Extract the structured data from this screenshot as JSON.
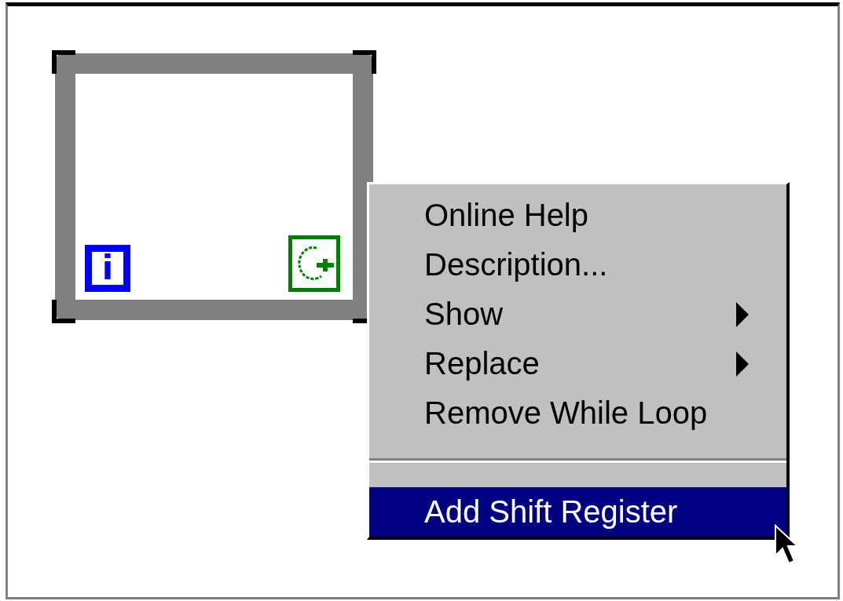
{
  "diagram": {
    "loop": {
      "kind": "while-loop",
      "iteration_terminal": "i"
    }
  },
  "context_menu": {
    "items": [
      {
        "kind": "item",
        "label": "Online Help",
        "submenu": false,
        "selected": false
      },
      {
        "kind": "item",
        "label": "Description...",
        "submenu": false,
        "selected": false
      },
      {
        "kind": "item",
        "label": "Show",
        "submenu": true,
        "selected": false
      },
      {
        "kind": "item",
        "label": "Replace",
        "submenu": true,
        "selected": false
      },
      {
        "kind": "item",
        "label": "Remove While Loop",
        "submenu": false,
        "selected": false
      },
      {
        "kind": "separator"
      },
      {
        "kind": "item",
        "label": "Add Shift Register",
        "submenu": false,
        "selected": true
      }
    ]
  }
}
